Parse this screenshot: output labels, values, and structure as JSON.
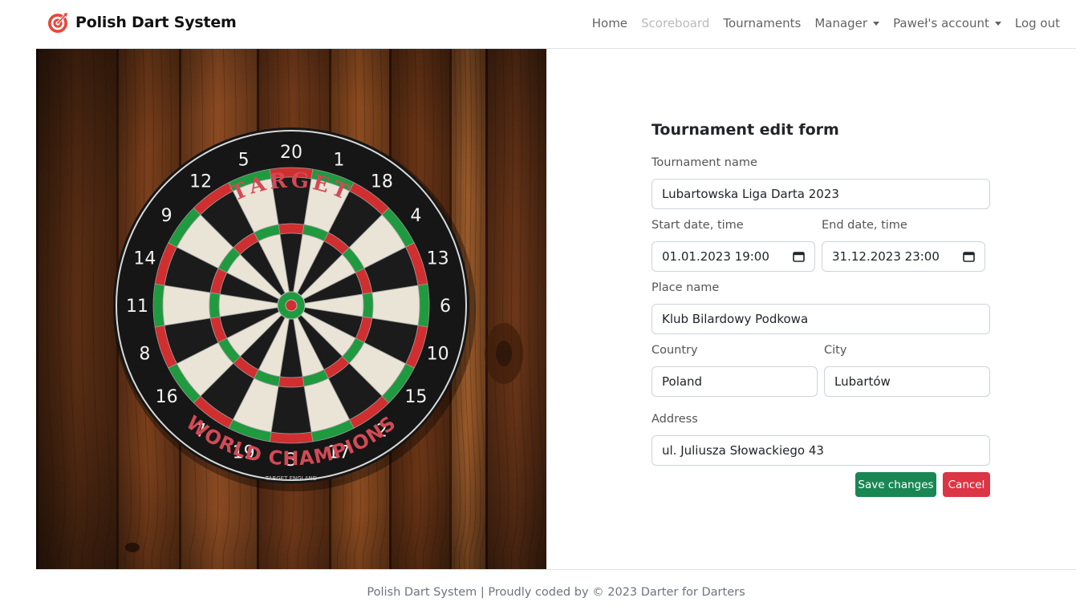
{
  "brand": {
    "name": "Polish Dart System",
    "logo_icon": "dart-target-icon",
    "accent_color": "#e8473a"
  },
  "nav": {
    "home": "Home",
    "scoreboard": "Scoreboard",
    "tournaments": "Tournaments",
    "manager": "Manager",
    "account": "Paweł's account",
    "logout": "Log out"
  },
  "hero": {
    "description_icon": "dartboard-photo",
    "board_top_text": "TARGET",
    "board_bottom_text": "WORLD CHAMPIONS",
    "board_small_text": "TARGET ENGLAND",
    "board_numbers": [
      "20",
      "1",
      "18",
      "4",
      "13",
      "6",
      "10",
      "15",
      "2",
      "17",
      "3",
      "19",
      "7",
      "16",
      "8",
      "11",
      "14",
      "9",
      "12",
      "5"
    ]
  },
  "form": {
    "title": "Tournament edit form",
    "tournament_name_label": "Tournament name",
    "tournament_name_value": "Lubartowska Liga Darta 2023",
    "start_label": "Start date, time",
    "start_value": "01.01.2023 19:00",
    "end_label": "End date, time",
    "end_value": "31.12.2023 23:00",
    "place_label": "Place name",
    "place_value": "Klub Bilardowy Podkowa",
    "country_label": "Country",
    "country_value": "Poland",
    "city_label": "City",
    "city_value": "Lubartów",
    "address_label": "Address",
    "address_value": "ul. Juliusza Słowackiego 43",
    "save_label": "Save changes",
    "cancel_label": "Cancel",
    "save_color": "#198754",
    "cancel_color": "#dc3545"
  },
  "footer": {
    "text": "Polish Dart System | Proudly coded by © 2023 Darter for Darters"
  }
}
